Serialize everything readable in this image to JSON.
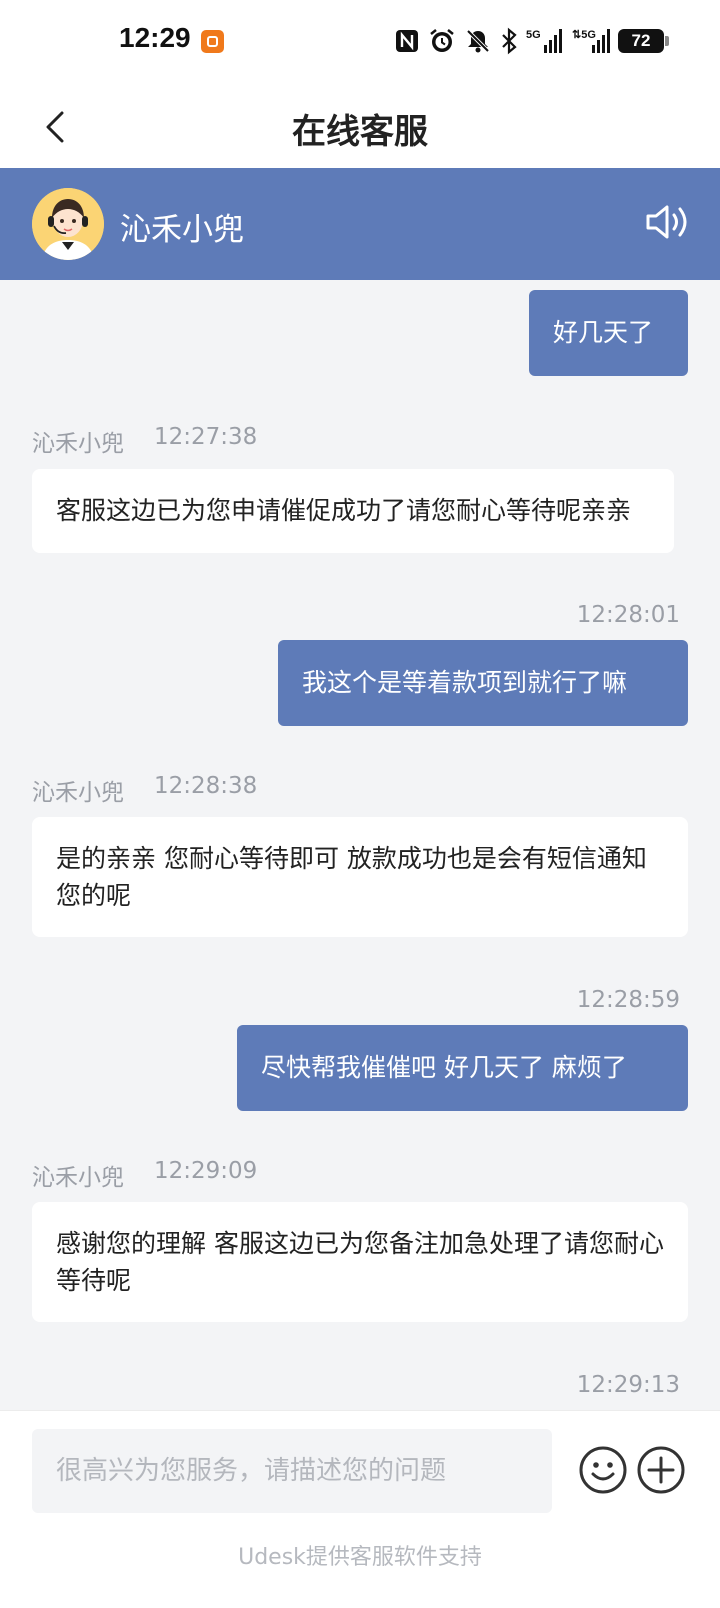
{
  "status_bar": {
    "time": "12:29",
    "battery": "72",
    "icons": [
      "nfc-icon",
      "alarm-icon",
      "mute-icon",
      "bluetooth-icon",
      "signal-5g-icon",
      "signal-5g-icon"
    ]
  },
  "nav": {
    "title": "在线客服"
  },
  "agent": {
    "name": "沁禾小兜"
  },
  "messages": [
    {
      "dir": "out",
      "text": "好几天了"
    },
    {
      "dir": "in",
      "sender": "沁禾小兜",
      "time": "12:27:38",
      "text": "客服这边已为您申请催促成功了请您耐心等待呢亲亲"
    },
    {
      "dir": "out",
      "time": "12:28:01",
      "text": "我这个是等着款项到就行了嘛"
    },
    {
      "dir": "in",
      "sender": "沁禾小兜",
      "time": "12:28:38",
      "text": "是的亲亲 您耐心等待即可 放款成功也是会有短信通知您的呢"
    },
    {
      "dir": "out",
      "time": "12:28:59",
      "text": "尽快帮我催催吧 好几天了 麻烦了"
    },
    {
      "dir": "in",
      "sender": "沁禾小兜",
      "time": "12:29:09",
      "text": "感谢您的理解 客服这边已为您备注加急处理了请您耐心等待呢"
    },
    {
      "dir": "out",
      "time": "12:29:13",
      "text": ""
    }
  ],
  "input": {
    "placeholder": "很高兴为您服务，请描述您的问题"
  },
  "footer": {
    "note": "Udesk提供客服软件支持"
  },
  "colors": {
    "accent": "#5e7bb8",
    "background": "#f3f4f6",
    "meta_text": "#9a9ea6"
  }
}
